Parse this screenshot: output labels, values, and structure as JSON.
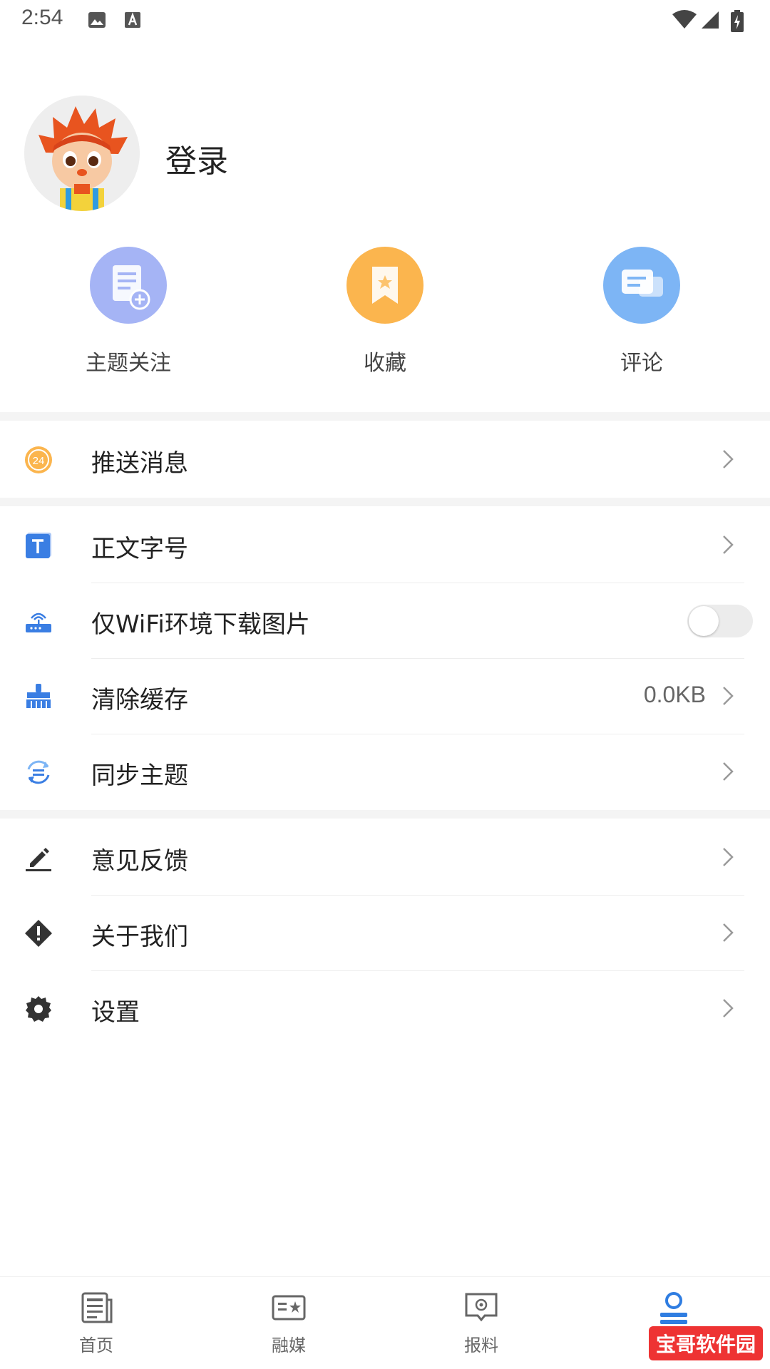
{
  "status_bar": {
    "time": "2:54"
  },
  "profile": {
    "login_label": "登录"
  },
  "quick_actions": [
    {
      "label": "主题关注",
      "icon": "topic-follow-icon",
      "color": "#a5b4f5"
    },
    {
      "label": "收藏",
      "icon": "bookmark-icon",
      "color": "#fbb54e"
    },
    {
      "label": "评论",
      "icon": "comment-icon",
      "color": "#7db5f5"
    }
  ],
  "menu": {
    "push": {
      "label": "推送消息",
      "icon": "push-24-icon"
    },
    "font_size": {
      "label": "正文字号",
      "icon": "text-size-icon"
    },
    "wifi_images": {
      "label": "仅WiFi环境下载图片",
      "icon": "router-icon",
      "enabled": false
    },
    "clear_cache": {
      "label": "清除缓存",
      "value": "0.0KB",
      "icon": "broom-icon"
    },
    "sync_topics": {
      "label": "同步主题",
      "icon": "sync-icon"
    },
    "feedback": {
      "label": "意见反馈",
      "icon": "pencil-icon"
    },
    "about": {
      "label": "关于我们",
      "icon": "info-diamond-icon"
    },
    "settings": {
      "label": "设置",
      "icon": "gear-icon"
    }
  },
  "bottom_nav": [
    {
      "label": "首页",
      "icon": "home-news-icon",
      "active": false
    },
    {
      "label": "融媒",
      "icon": "media-icon",
      "active": false
    },
    {
      "label": "报料",
      "icon": "report-icon",
      "active": false
    },
    {
      "label": "我",
      "icon": "user-icon",
      "active": true
    }
  ],
  "watermark": "宝哥软件园",
  "colors": {
    "accent": "#2f7de1",
    "icon_blue": "#3a7ee3",
    "icon_dark": "#333333"
  }
}
